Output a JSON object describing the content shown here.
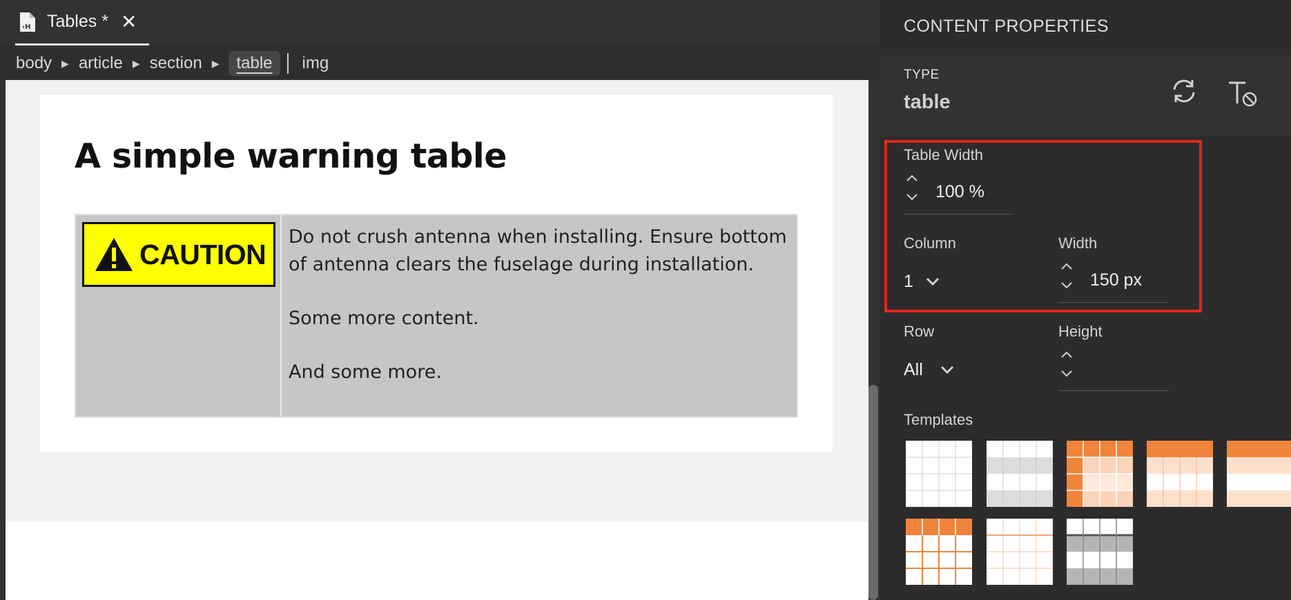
{
  "tab": {
    "title": "Tables *",
    "close": "✕"
  },
  "breadcrumb": {
    "items": [
      "body",
      "article",
      "section",
      "table",
      "img"
    ],
    "sep": "▶"
  },
  "document": {
    "heading": "A simple warning table",
    "caution_word": "CAUTION",
    "paragraphs": [
      "Do not crush antenna when installing. Ensure bottom of antenna clears the fuselage during installation.",
      "Some more content.",
      "And some more."
    ]
  },
  "panel": {
    "heading": "CONTENT PROPERTIES",
    "type_label": "TYPE",
    "type_value": "table",
    "table_width_label": "Table Width",
    "table_width_value": "100 %",
    "column_label": "Column",
    "column_value": "1",
    "width_label": "Width",
    "width_value": "150 px",
    "row_label": "Row",
    "row_value": "All",
    "height_label": "Height",
    "templates_label": "Templates"
  },
  "colors": {
    "accent_orange": "#f0843a",
    "highlight_red": "#e5261a",
    "caution_yellow": "#ffff00"
  }
}
